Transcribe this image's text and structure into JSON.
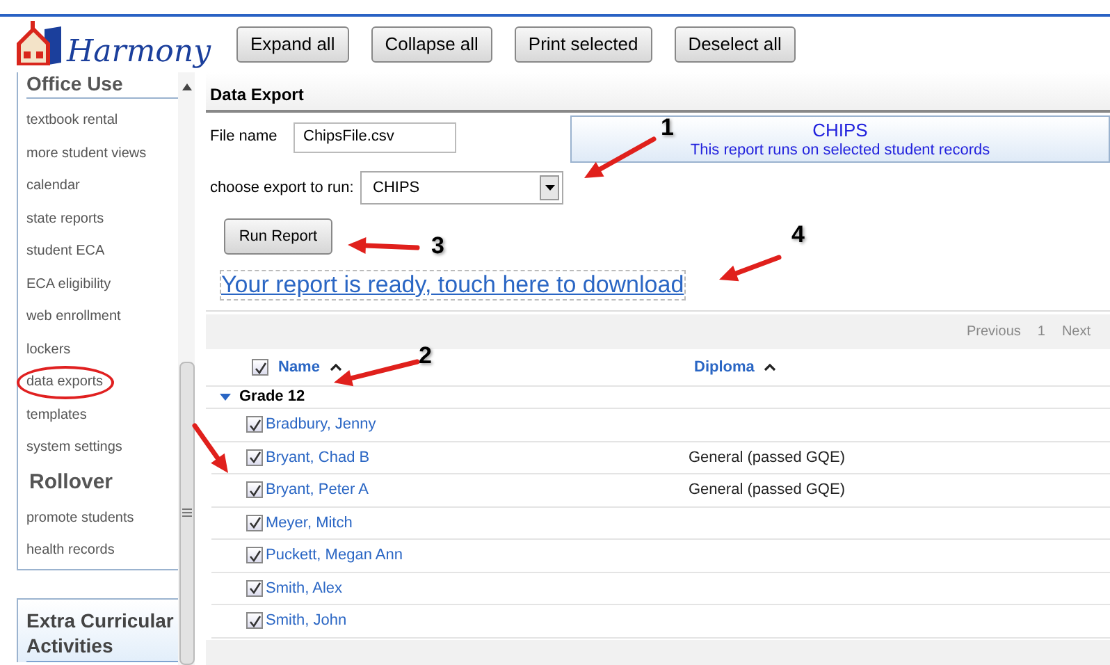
{
  "header": {
    "logo": "Harmony",
    "buttons": [
      "Expand all",
      "Collapse all",
      "Print selected",
      "Deselect all"
    ]
  },
  "sidebar": {
    "panels": [
      {
        "items": [
          {
            "kind": "heading",
            "label": "Office Use"
          },
          {
            "kind": "link",
            "label": "textbook rental",
            "circled": false
          },
          {
            "kind": "link",
            "label": "more student views",
            "circled": false
          },
          {
            "kind": "link",
            "label": "calendar",
            "circled": false
          },
          {
            "kind": "link",
            "label": "state reports",
            "circled": false
          },
          {
            "kind": "link",
            "label": "student ECA",
            "circled": false
          },
          {
            "kind": "link",
            "label": "ECA eligibility",
            "circled": false
          },
          {
            "kind": "link",
            "label": "web enrollment",
            "circled": false
          },
          {
            "kind": "link",
            "label": "lockers",
            "circled": false
          },
          {
            "kind": "link",
            "label": "data exports",
            "circled": true
          },
          {
            "kind": "link",
            "label": "templates",
            "circled": false
          },
          {
            "kind": "link",
            "label": "system settings",
            "circled": false
          },
          {
            "kind": "heading",
            "label": "Rollover"
          },
          {
            "kind": "link",
            "label": "promote students",
            "circled": false
          },
          {
            "kind": "link",
            "label": "health records",
            "circled": false
          }
        ]
      },
      {
        "items": [
          {
            "kind": "heading",
            "label": "Extra Curricular Activities"
          }
        ]
      }
    ]
  },
  "data_export": {
    "title": "Data Export",
    "file_name_label": "File name",
    "file_name": "ChipsFile.csv",
    "export_label": "choose export to run:",
    "export_value": "CHIPS",
    "info_title": "CHIPS",
    "info_text": "This report runs on selected student records",
    "run_button": "Run Report",
    "download_link": "Your report is ready, touch here to download"
  },
  "pager": {
    "previous": "Previous",
    "page": "1",
    "next": "Next"
  },
  "table": {
    "select_all_checked": true,
    "columns": [
      "Name",
      "Diploma"
    ],
    "group": {
      "label": "Grade 12",
      "expanded": true
    },
    "rows": [
      {
        "name": "Bradbury, Jenny",
        "diploma": "",
        "checked": true
      },
      {
        "name": "Bryant, Chad B",
        "diploma": "General (passed GQE)",
        "checked": true
      },
      {
        "name": "Bryant, Peter A",
        "diploma": "General (passed GQE)",
        "checked": true
      },
      {
        "name": "Meyer, Mitch",
        "diploma": "",
        "checked": true
      },
      {
        "name": "Puckett, Megan Ann",
        "diploma": "",
        "checked": true
      },
      {
        "name": "Smith, Alex",
        "diploma": "",
        "checked": true
      },
      {
        "name": "Smith, John",
        "diploma": "",
        "checked": true
      }
    ]
  },
  "annotations": [
    {
      "kind": "arrow",
      "label": "1"
    },
    {
      "kind": "arrow",
      "label": "2"
    },
    {
      "kind": "arrow",
      "label": "3"
    },
    {
      "kind": "arrow",
      "label": "4"
    },
    {
      "kind": "arrow"
    }
  ]
}
